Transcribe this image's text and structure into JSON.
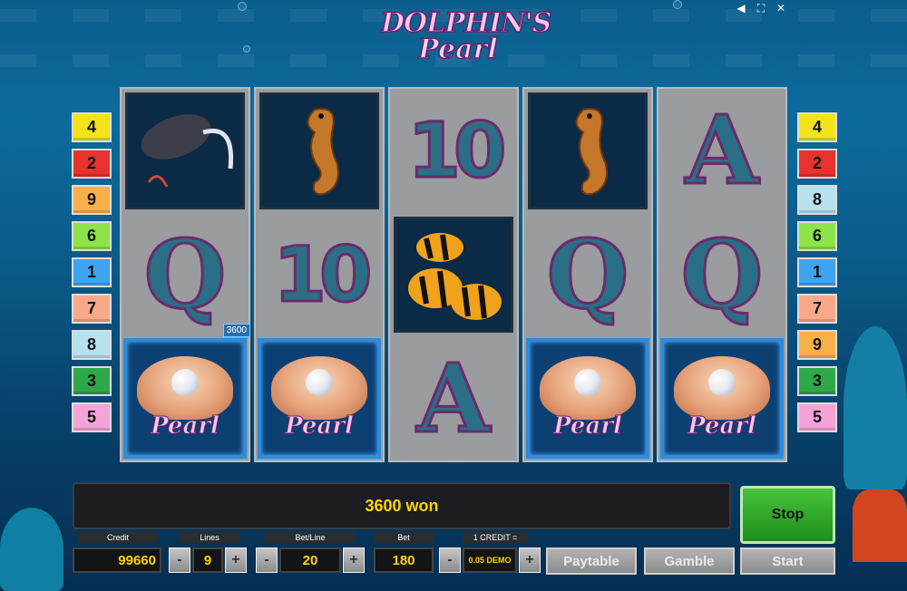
{
  "window_controls": {
    "sound_icon": "speaker-icon",
    "fullscreen_icon": "fullscreen-icon",
    "close_icon": "close-icon"
  },
  "logo": {
    "line1": "DOLPHIN'S",
    "line2": "Pearl"
  },
  "reels": [
    [
      "stingray",
      "Q",
      "pearl"
    ],
    [
      "seahorse",
      "10",
      "pearl"
    ],
    [
      "10",
      "fish",
      "A"
    ],
    [
      "seahorse",
      "Q",
      "pearl"
    ],
    [
      "A",
      "Q",
      "pearl"
    ]
  ],
  "pearl_text": "Pearl",
  "win_badge": "3600",
  "left_lines": [
    {
      "label": "4",
      "color": "#f4e21a"
    },
    {
      "label": "2",
      "color": "#e8322d"
    },
    {
      "label": "9",
      "color": "#f9b04a"
    },
    {
      "label": "6",
      "color": "#8ee34b"
    },
    {
      "label": "1",
      "color": "#3ea3f0"
    },
    {
      "label": "7",
      "color": "#f7a98a"
    },
    {
      "label": "8",
      "color": "#b8e1ee"
    },
    {
      "label": "3",
      "color": "#2fa84a"
    },
    {
      "label": "5",
      "color": "#f5a3d9"
    }
  ],
  "right_lines": [
    {
      "label": "4",
      "color": "#f4e21a"
    },
    {
      "label": "2",
      "color": "#e8322d"
    },
    {
      "label": "8",
      "color": "#b8e1ee"
    },
    {
      "label": "6",
      "color": "#8ee34b"
    },
    {
      "label": "1",
      "color": "#3ea3f0"
    },
    {
      "label": "7",
      "color": "#f7a98a"
    },
    {
      "label": "9",
      "color": "#f9b04a"
    },
    {
      "label": "3",
      "color": "#2fa84a"
    },
    {
      "label": "5",
      "color": "#f5a3d9"
    }
  ],
  "win_message": "3600 won",
  "stop_label": "Stop",
  "panel": {
    "credit_label": "Credit",
    "credit_value": "99660",
    "lines_label": "Lines",
    "lines_value": "9",
    "betline_label": "Bet/Line",
    "betline_value": "20",
    "bet_label": "Bet",
    "bet_value": "180",
    "credit_rate_label": "1 CREDIT =",
    "credit_rate_value": "0.05 DEMO",
    "minus": "-",
    "plus": "+",
    "paytable_label": "Paytable",
    "gamble_label": "Gamble",
    "start_label": "Start"
  }
}
